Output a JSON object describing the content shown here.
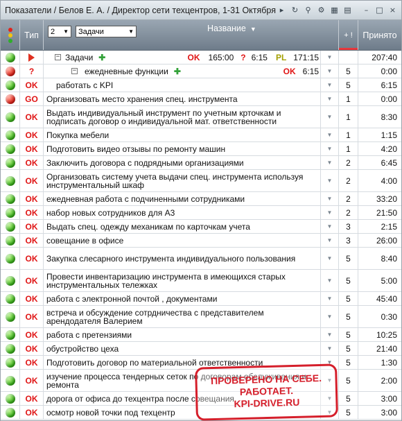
{
  "window": {
    "title": "Показатели / Белов Е. А. / Директор сети техцентров, 1-31 Октября",
    "icons": [
      "play-icon",
      "refresh-icon",
      "search-icon",
      "settings-icon",
      "table-icon",
      "export-icon",
      "minimize-icon",
      "maximize-icon",
      "close-icon"
    ],
    "icon_glyphs": [
      "▸",
      "↻",
      "⚲",
      "⚙",
      "▦",
      "▤",
      "–",
      "□",
      "×"
    ]
  },
  "header": {
    "type_label": "Тип",
    "level_value": "2",
    "category_value": "Задачи",
    "name_label": "Название",
    "sort_label": "+ !",
    "accepted_label": "Принято"
  },
  "stamp": {
    "line1": "ПРОВЕРЕНО НА СЕБЕ.",
    "line2": "РАБОТАЕТ.",
    "line3": "KPI-DRIVE.RU"
  },
  "rows": [
    {
      "kind": "group",
      "status": "green",
      "type": "flag",
      "name": "Задачи",
      "ok": "OK",
      "v1": "165:00",
      "q": "?",
      "v2": "6:15",
      "pl": "PL",
      "v3": "171:15",
      "sort": "",
      "accepted": "207:40"
    },
    {
      "kind": "subgroup",
      "status": "red",
      "type": "?",
      "name": "ежедневные функции",
      "ok": "OK",
      "v2": "6:15",
      "sort": "5",
      "accepted": "0:00"
    },
    {
      "kind": "task",
      "status": "green",
      "type": "OK",
      "name": "работать с KPI",
      "sort": "5",
      "accepted": "6:15",
      "indent": 2
    },
    {
      "kind": "task",
      "status": "red",
      "type": "GO",
      "name": "Организовать место хранения спец. инструмента",
      "sort": "1",
      "accepted": "0:00"
    },
    {
      "kind": "task",
      "status": "green",
      "type": "OK",
      "name": "Выдать индивидуальный инструмент по учетным крточкам и подписать договор о индивидуальной мат. ответственности",
      "sort": "1",
      "accepted": "8:30"
    },
    {
      "kind": "task",
      "status": "green",
      "type": "OK",
      "name": "Покупка мебели",
      "sort": "1",
      "accepted": "1:15"
    },
    {
      "kind": "task",
      "status": "green",
      "type": "OK",
      "name": "Подготовить видео отзывы по ремонту машин",
      "sort": "1",
      "accepted": "4:20"
    },
    {
      "kind": "task",
      "status": "green",
      "type": "OK",
      "name": "Заключить договора с подрядными организациями",
      "sort": "2",
      "accepted": "6:45"
    },
    {
      "kind": "task",
      "status": "green",
      "type": "OK",
      "name": "Организовать систему учета выдачи спец. инструмента используя инструментальный шкаф",
      "sort": "2",
      "accepted": "4:00"
    },
    {
      "kind": "task",
      "status": "green",
      "type": "OK",
      "name": "ежедневная работа с подчиненными сотрудниками",
      "sort": "2",
      "accepted": "33:20"
    },
    {
      "kind": "task",
      "status": "green",
      "type": "OK",
      "name": "набор новых сотрудников для А3",
      "sort": "2",
      "accepted": "21:50"
    },
    {
      "kind": "task",
      "status": "green",
      "type": "OK",
      "name": "Выдать спец. одежду механикам по карточкам учета",
      "sort": "3",
      "accepted": "2:15"
    },
    {
      "kind": "task",
      "status": "green",
      "type": "OK",
      "name": "совещание в офисе",
      "sort": "3",
      "accepted": "26:00"
    },
    {
      "kind": "task",
      "status": "green",
      "type": "OK",
      "name": "Закупка слесарного инструмента индивидуального пользования",
      "sort": "5",
      "accepted": "8:40"
    },
    {
      "kind": "task",
      "status": "green",
      "type": "OK",
      "name": "Провести инвентаризацию инструмента в имеющихся старых инструментальных тележках",
      "sort": "5",
      "accepted": "5:00"
    },
    {
      "kind": "task",
      "status": "green",
      "type": "OK",
      "name": "работа с электронной почтой , документами",
      "sort": "5",
      "accepted": "45:40"
    },
    {
      "kind": "task",
      "status": "green",
      "type": "OK",
      "name": "встреча и обсуждение сотрдничества с представителем арендодателя Валерием",
      "sort": "5",
      "accepted": "0:30"
    },
    {
      "kind": "task",
      "status": "green",
      "type": "OK",
      "name": "работа с претензиями",
      "sort": "5",
      "accepted": "10:25"
    },
    {
      "kind": "task",
      "status": "green",
      "type": "OK",
      "name": "обустройство цеха",
      "sort": "5",
      "accepted": "21:40"
    },
    {
      "kind": "task",
      "status": "green",
      "type": "OK",
      "name": "Подготовить договор по материальной ответственности",
      "sort": "5",
      "accepted": "1:30"
    },
    {
      "kind": "task",
      "status": "green",
      "type": "OK",
      "name": "изучение процесса тендерных сеток по договорам обслуживания и ремонта",
      "sort": "5",
      "accepted": "2:00"
    },
    {
      "kind": "task",
      "status": "green",
      "type": "OK",
      "name": "дорога от офиса до техцентра после совещания",
      "sort": "5",
      "accepted": "3:00"
    },
    {
      "kind": "task",
      "status": "green",
      "type": "OK",
      "name": "осмотр новой точки под техцентр",
      "sort": "5",
      "accepted": "3:00"
    }
  ]
}
